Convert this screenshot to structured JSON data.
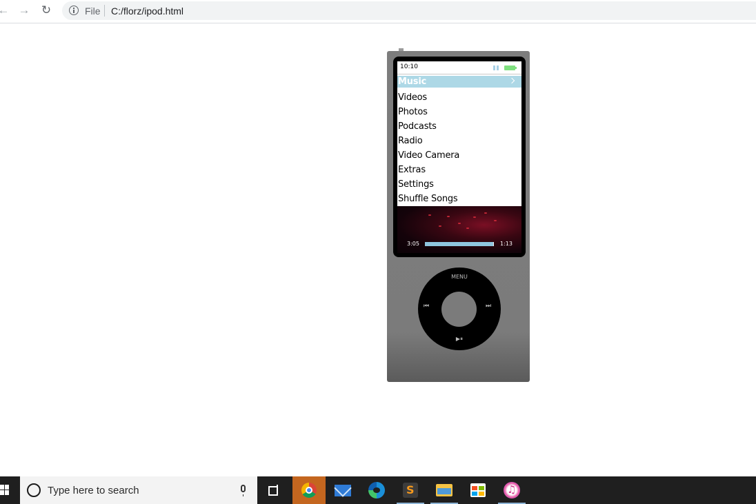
{
  "browser": {
    "scheme_label": "File",
    "url": "C:/florz/ipod.html"
  },
  "ipod": {
    "status": {
      "time": "10:10"
    },
    "menu": {
      "items": [
        "Music",
        "Videos",
        "Photos",
        "Podcasts",
        "Radio",
        "Video Camera",
        "Extras",
        "Settings",
        "Shuffle Songs"
      ],
      "selected_index": 0
    },
    "now_playing": {
      "elapsed": "3:05",
      "remaining": "1:13",
      "progress": 0.99
    },
    "wheel": {
      "menu_label": "MENU",
      "prev_icon": "⏮",
      "next_icon": "⏭",
      "play_pause_icon": "▶⏸"
    },
    "colors": {
      "body": "#7b7b7b",
      "selection": "#add8e6",
      "battery": "#7fe07f"
    }
  },
  "taskbar": {
    "search_placeholder": "Type here to search",
    "apps": [
      "chrome-icon",
      "mail-icon",
      "edge-icon",
      "sublime-text-icon",
      "file-explorer-icon",
      "microsoft-store-icon",
      "itunes-icon"
    ]
  }
}
